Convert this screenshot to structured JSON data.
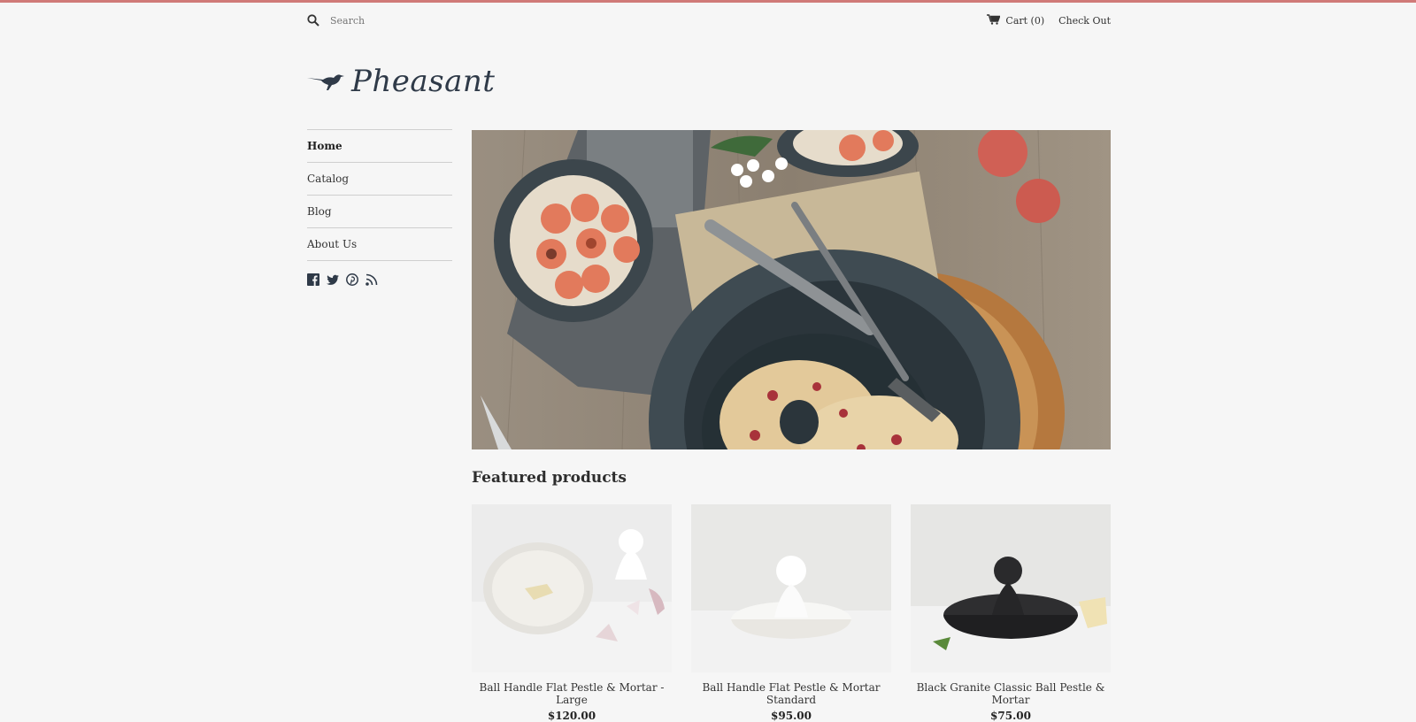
{
  "topbar": {
    "search_placeholder": "Search",
    "cart_label": "Cart (0)",
    "checkout_label": "Check Out"
  },
  "brand": {
    "name": "Pheasant"
  },
  "nav": {
    "items": [
      {
        "label": "Home"
      },
      {
        "label": "Catalog"
      },
      {
        "label": "Blog"
      },
      {
        "label": "About Us"
      }
    ]
  },
  "social_icons": [
    "facebook-icon",
    "twitter-icon",
    "pinterest-icon",
    "rss-icon"
  ],
  "main": {
    "featured_title": "Featured products",
    "products": [
      {
        "name": "Ball Handle Flat Pestle & Mortar - Large",
        "price": "$120.00"
      },
      {
        "name": "Ball Handle Flat Pestle & Mortar Standard",
        "price": "$95.00"
      },
      {
        "name": "Black Granite Classic Ball Pestle & Mortar",
        "price": "$75.00"
      }
    ]
  },
  "colors": {
    "accent_bar": "#d07a78",
    "background": "#f6f6f6",
    "logo": "#2f3a48"
  }
}
